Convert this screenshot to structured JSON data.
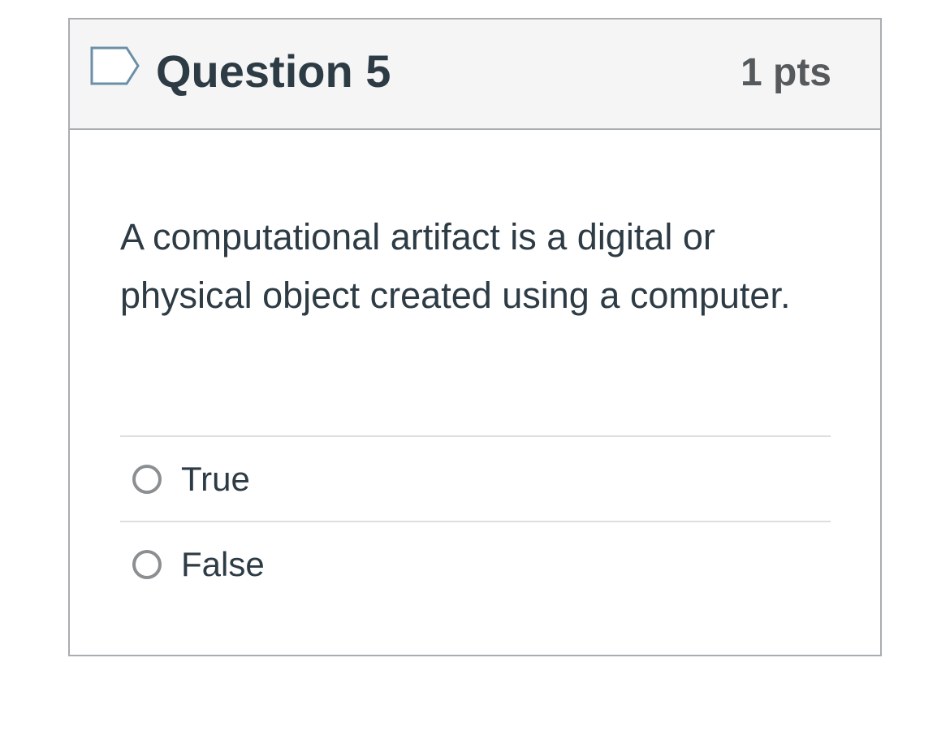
{
  "question": {
    "title": "Question 5",
    "points": "1 pts",
    "flag_icon": "flag-outline-icon",
    "text": "A computational artifact is a digital or physical object created using a computer.",
    "answers": [
      {
        "label": "True",
        "selected": false
      },
      {
        "label": "False",
        "selected": false
      }
    ]
  },
  "colors": {
    "header_background": "#f5f5f5",
    "border": "#a9adb0",
    "text": "#2d3b45",
    "points_text": "#565a5c",
    "radio_border": "#8b8f92",
    "flag_stroke": "#6b8fa8"
  }
}
